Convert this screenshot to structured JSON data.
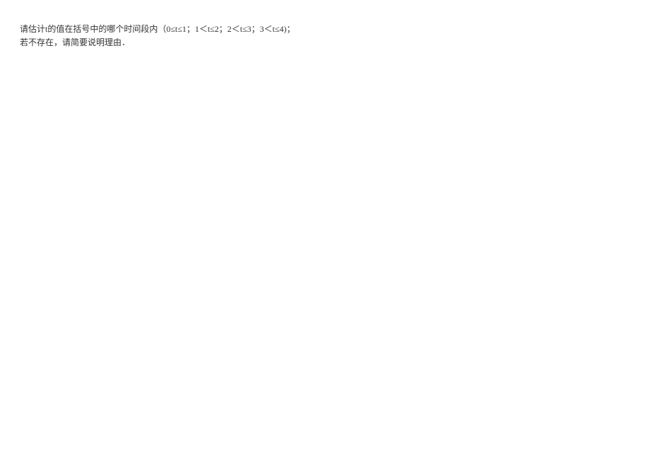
{
  "document": {
    "line1": "请估计t的值在括号中的哪个时间段内（0≤t≤1；1＜t≤2；2＜t≤3；3＜t≤4)；",
    "line2": "若不存在，请简要说明理由．"
  }
}
